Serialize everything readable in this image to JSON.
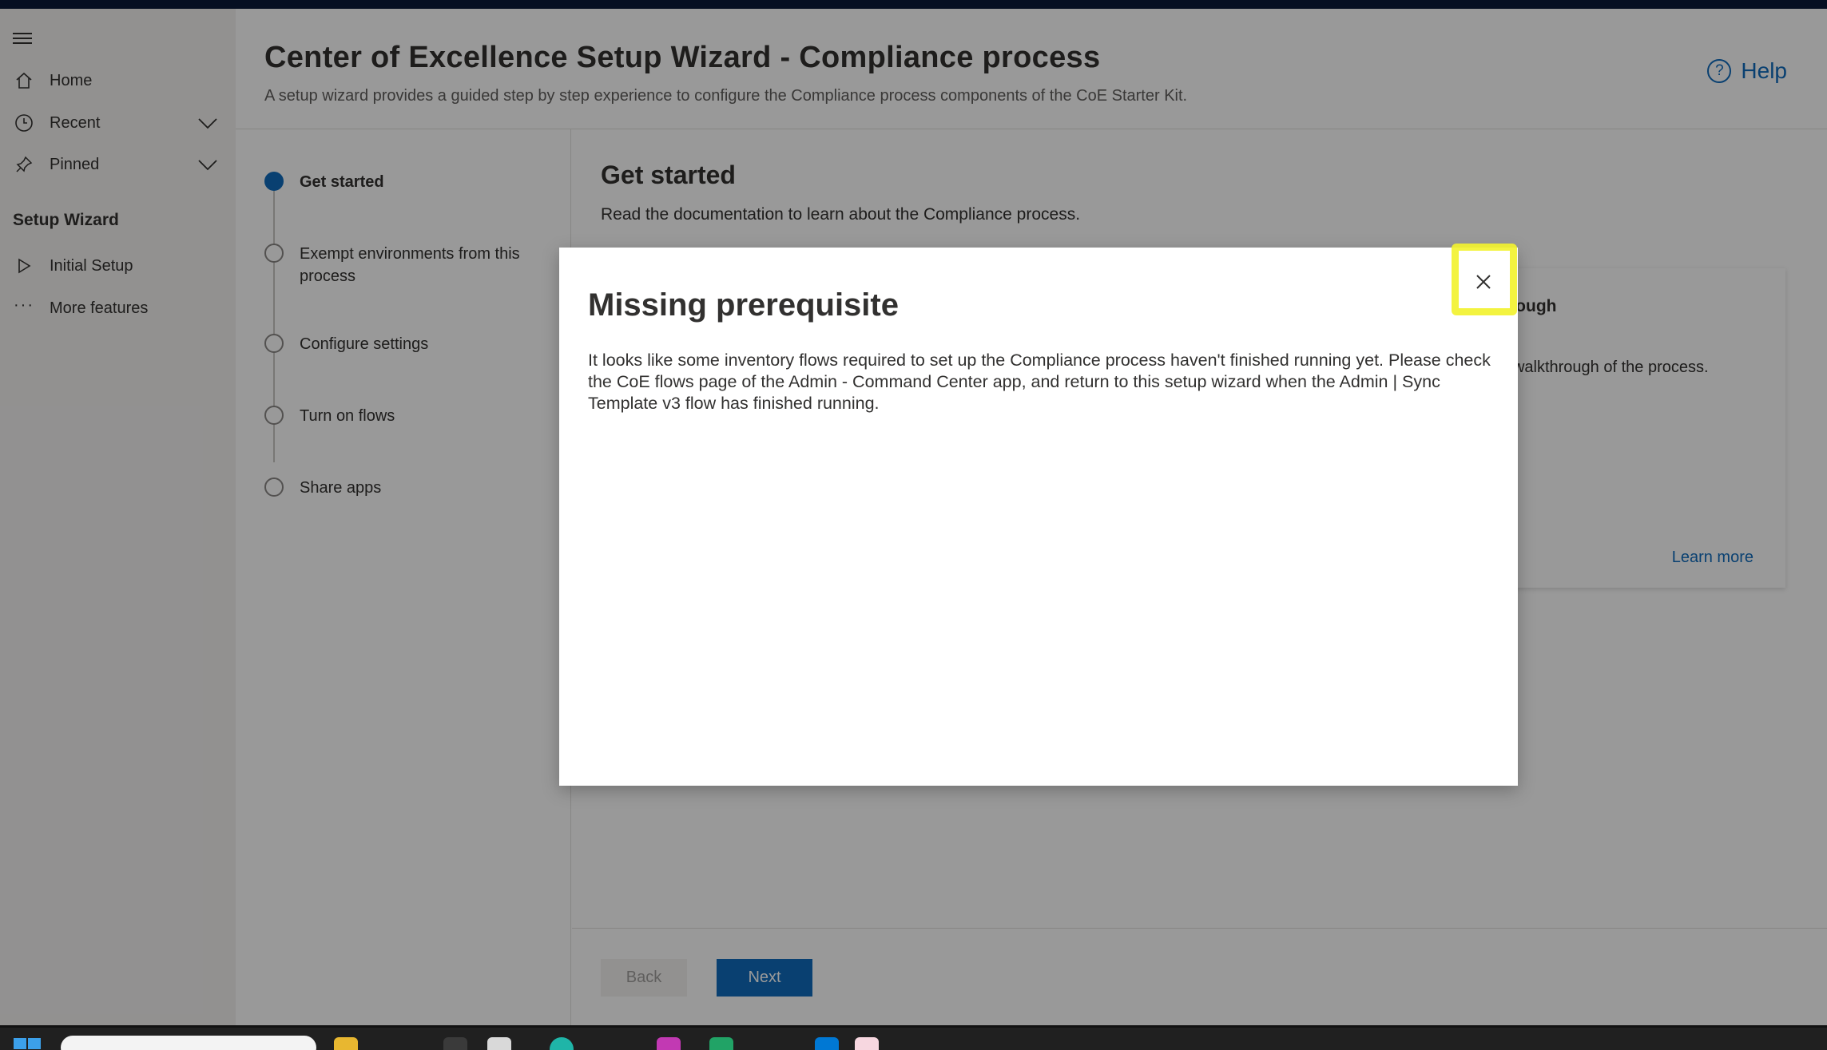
{
  "sidebar": {
    "items": [
      {
        "label": "Home",
        "icon": "home-icon"
      },
      {
        "label": "Recent",
        "icon": "clock-icon"
      },
      {
        "label": "Pinned",
        "icon": "pin-icon"
      }
    ],
    "section_title": "Setup Wizard",
    "section_items": [
      {
        "label": "Initial Setup",
        "icon": "play-icon"
      },
      {
        "label": "More features",
        "icon": "more-icon"
      }
    ]
  },
  "header": {
    "title": "Center of Excellence Setup Wizard - Compliance process",
    "subtitle": "A setup wizard provides a guided step by step experience to configure the Compliance process components of the CoE Starter Kit.",
    "help_label": "Help"
  },
  "steps": [
    {
      "label": "Get started",
      "active": true
    },
    {
      "label": "Exempt environments from this process",
      "active": false
    },
    {
      "label": "Configure settings",
      "active": false
    },
    {
      "label": "Turn on flows",
      "active": false
    },
    {
      "label": "Share apps",
      "active": false
    }
  ],
  "content": {
    "title": "Get started",
    "description": "Read the documentation to learn about the Compliance process."
  },
  "card": {
    "title": "o walkthrough",
    "text": "ideo for a walkthrough of the process.",
    "link": "Learn more"
  },
  "footer": {
    "back_label": "Back",
    "next_label": "Next"
  },
  "dialog": {
    "title": "Missing prerequisite",
    "body": "It looks like some inventory flows required to set up the Compliance process haven't finished running yet. Please check the CoE flows page of the Admin - Command Center app, and return to this setup wizard when the Admin | Sync Template v3 flow has finished running."
  },
  "colors": {
    "accent": "#0f6cbd",
    "highlight": "#f2f230",
    "sidebar_bg": "#f3f2f1"
  }
}
